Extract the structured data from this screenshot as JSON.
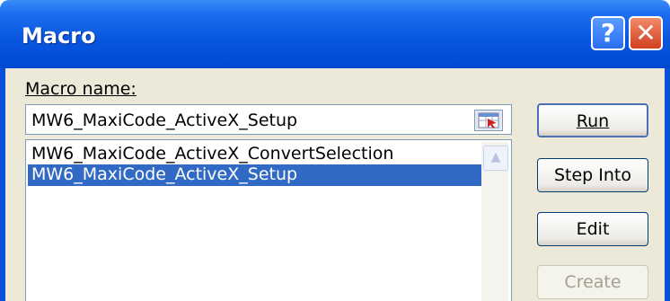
{
  "window": {
    "title": "Macro"
  },
  "title_buttons": {
    "help": "?",
    "close": "✕"
  },
  "macro_name_label": "Macro name:",
  "macro_name_value": "MW6_MaxiCode_ActiveX_Setup",
  "macros": [
    {
      "name": "MW6_MaxiCode_ActiveX_ConvertSelection",
      "selected": false
    },
    {
      "name": "MW6_MaxiCode_ActiveX_Setup",
      "selected": true
    }
  ],
  "buttons": {
    "run": "Run",
    "step_into": "Step Into",
    "edit": "Edit",
    "create": "Create"
  },
  "colors": {
    "title_bar": "#0a58e0",
    "selection": "#316ac5",
    "dialog_bg": "#ece9d8"
  }
}
